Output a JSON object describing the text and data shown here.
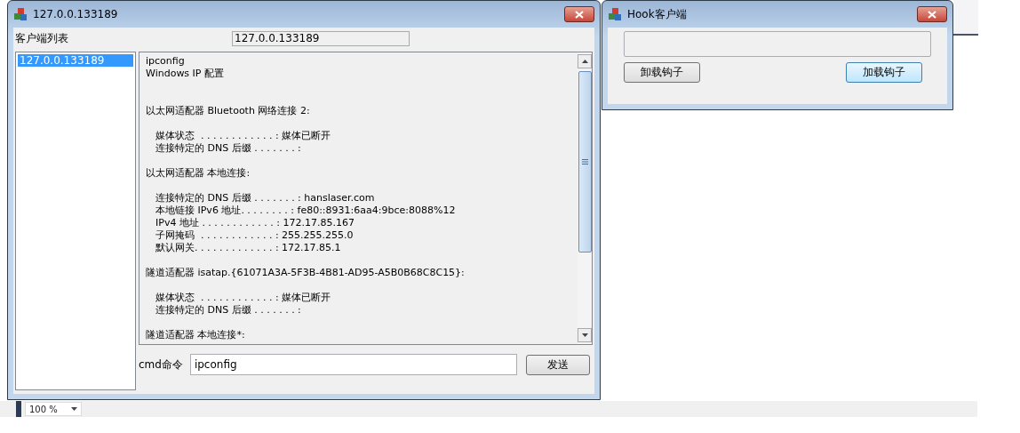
{
  "main_window": {
    "title": "127.0.0.133189",
    "client_list_label": "客户端列表",
    "selected_client": "127.0.0.133189",
    "clients": [
      {
        "label": "127.0.0.133189",
        "selected": true
      }
    ],
    "output": [
      {
        "text": "ipconfig",
        "kind": "command"
      },
      {
        "text": "Windows IP 配置",
        "kind": "command"
      },
      {
        "text": "以太网适配器 Bluetooth 网络连接 2:",
        "kind": "heading"
      },
      {
        "text": "媒体状态  . . . . . . . . . . . . : 媒体已断开",
        "kind": "detail"
      },
      {
        "text": "连接特定的 DNS 后缀 . . . . . . . :",
        "kind": "detail"
      },
      {
        "text": "以太网适配器 本地连接:",
        "kind": "heading"
      },
      {
        "text": "连接特定的 DNS 后缀 . . . . . . . : hanslaser.com",
        "kind": "detail"
      },
      {
        "text": "本地链接 IPv6 地址. . . . . . . . : fe80::8931:6aa4:9bce:8088%12",
        "kind": "detail"
      },
      {
        "text": "IPv4 地址 . . . . . . . . . . . . : 172.17.85.167",
        "kind": "detail"
      },
      {
        "text": "子网掩码  . . . . . . . . . . . . : 255.255.255.0",
        "kind": "detail"
      },
      {
        "text": "默认网关. . . . . . . . . . . . . : 172.17.85.1",
        "kind": "detail"
      },
      {
        "text": "隧道适配器 isatap.{61071A3A-5F3B-4B81-AD95-A5B0B68C8C15}:",
        "kind": "heading"
      },
      {
        "text": "媒体状态  . . . . . . . . . . . . : 媒体已断开",
        "kind": "detail"
      },
      {
        "text": "连接特定的 DNS 后缀 . . . . . . . :",
        "kind": "detail"
      },
      {
        "text": "隧道适配器 本地连接*:",
        "kind": "heading"
      }
    ],
    "cmd_label": "cmd命令",
    "cmd_value": "ipconfig",
    "send_button": "发送"
  },
  "hook_window": {
    "title": "Hook客户端",
    "buttons": [
      {
        "label": "卸载钩子",
        "focused": false
      },
      {
        "label": "加载钩子",
        "focused": true
      }
    ]
  },
  "background": {
    "zoom": "100 %"
  }
}
